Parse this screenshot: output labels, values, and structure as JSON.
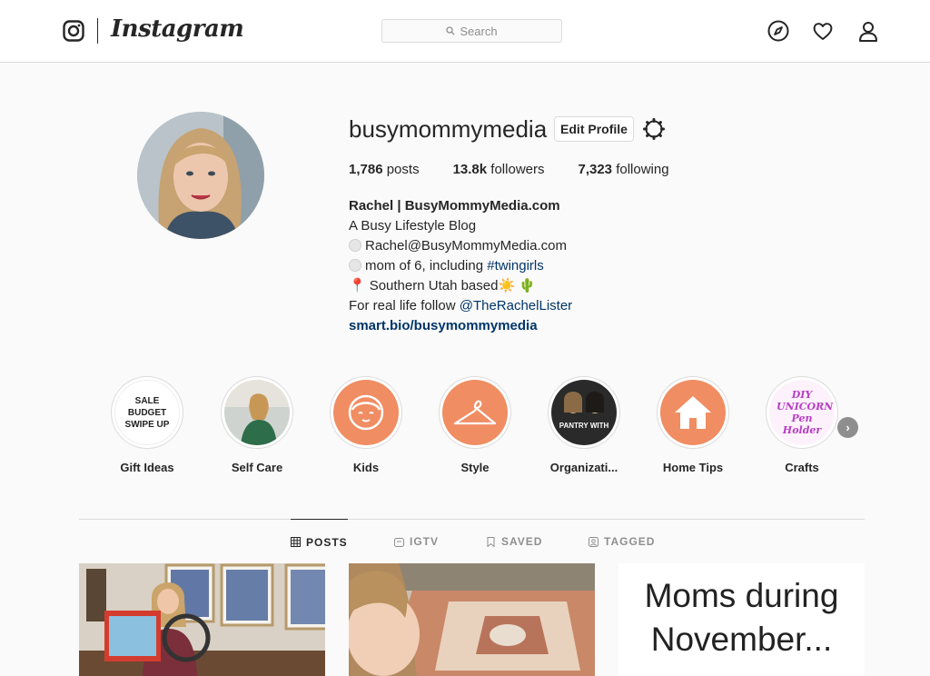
{
  "nav": {
    "brand": "Instagram",
    "search_placeholder": "Search"
  },
  "profile": {
    "username": "busymommymedia",
    "edit_label": "Edit Profile",
    "stats": {
      "posts_count": "1,786",
      "posts_label": "posts",
      "followers_count": "13.8k",
      "followers_label": "followers",
      "following_count": "7,323",
      "following_label": "following"
    },
    "bio": {
      "name": "Rachel | BusyMommyMedia.com",
      "line1": "A Busy Lifestyle Blog",
      "line2": "Rachel@BusyMommyMedia.com",
      "line3_text": "mom of 6, including ",
      "line3_tag": "#twingirls",
      "line4": "Southern Utah based",
      "line4_emoji": "☀️ 🌵",
      "line5_text": "For real life follow ",
      "line5_handle": "@TheRachelLister",
      "url": "smart.bio/busymommymedia"
    }
  },
  "highlights": [
    {
      "label": "Gift Ideas",
      "icon": "sale-cover",
      "cover_text": "SALE BUDGET SWIPE UP"
    },
    {
      "label": "Self Care",
      "icon": "photo-cover"
    },
    {
      "label": "Kids",
      "icon": "child-face-icon"
    },
    {
      "label": "Style",
      "icon": "hanger-icon"
    },
    {
      "label": "Organizati...",
      "icon": "photo-cover",
      "cover_text": "PANTRY WITH"
    },
    {
      "label": "Home Tips",
      "icon": "house-icon"
    },
    {
      "label": "Crafts",
      "icon": "craft-cover",
      "cover_text": "DIY UNICORN Pen Holder"
    }
  ],
  "tabs": [
    {
      "label": "POSTS",
      "icon": "grid-icon",
      "active": true
    },
    {
      "label": "IGTV",
      "icon": "tv-icon",
      "active": false
    },
    {
      "label": "SAVED",
      "icon": "bookmark-icon",
      "active": false
    },
    {
      "label": "TAGGED",
      "icon": "tagged-icon",
      "active": false
    }
  ],
  "posts": [
    {
      "type": "photo"
    },
    {
      "type": "photo"
    },
    {
      "type": "text",
      "text_line1": "Moms during",
      "text_line2": "November..."
    }
  ],
  "colors": {
    "accent_link": "#003569",
    "highlight_orange": "#f08d62",
    "border": "#dbdbdb",
    "muted": "#8e8e8e"
  }
}
